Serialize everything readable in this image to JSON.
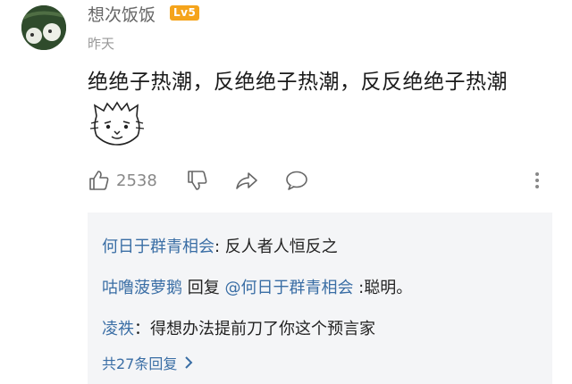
{
  "comment": {
    "username": "想次饭饭",
    "level_badge": "Lv5",
    "timestamp": "昨天",
    "text": "绝绝子热潮，反绝绝子热潮，反反绝绝子热潮",
    "sticker_icon": "cat-face-sticker-icon",
    "like_count": "2538"
  },
  "replies": [
    {
      "author": "何日于群青相会",
      "separator": ": ",
      "text": "反人者人恒反之"
    },
    {
      "author": "咕噜菠萝鹅",
      "reply_word": " 回复 ",
      "mention": "@何日于群青相会",
      "text": " :聪明。"
    },
    {
      "author": "凌祑",
      "separator": "：",
      "text": "得想办法提前刀了你这个预言家"
    }
  ],
  "more_replies_label": "共27条回复",
  "colors": {
    "link": "#3a6ea5",
    "badge": "#f5a41b",
    "reply_bg": "#f4f5f7"
  }
}
